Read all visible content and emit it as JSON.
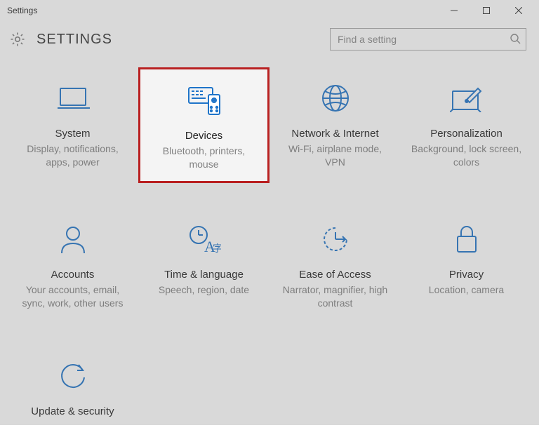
{
  "window": {
    "title": "Settings"
  },
  "header": {
    "title": "SETTINGS"
  },
  "search": {
    "placeholder": "Find a setting"
  },
  "tiles": [
    {
      "name": "system",
      "title": "System",
      "sub": "Display, notifications, apps, power"
    },
    {
      "name": "devices",
      "title": "Devices",
      "sub": "Bluetooth, printers, mouse",
      "highlight": true
    },
    {
      "name": "network",
      "title": "Network & Internet",
      "sub": "Wi-Fi, airplane mode, VPN"
    },
    {
      "name": "personalization",
      "title": "Personalization",
      "sub": "Background, lock screen, colors"
    },
    {
      "name": "accounts",
      "title": "Accounts",
      "sub": "Your accounts, email, sync, work, other users"
    },
    {
      "name": "time-language",
      "title": "Time & language",
      "sub": "Speech, region, date"
    },
    {
      "name": "ease-of-access",
      "title": "Ease of Access",
      "sub": "Narrator, magnifier, high contrast"
    },
    {
      "name": "privacy",
      "title": "Privacy",
      "sub": "Location, camera"
    },
    {
      "name": "update-security",
      "title": "Update & security",
      "sub": ""
    }
  ]
}
